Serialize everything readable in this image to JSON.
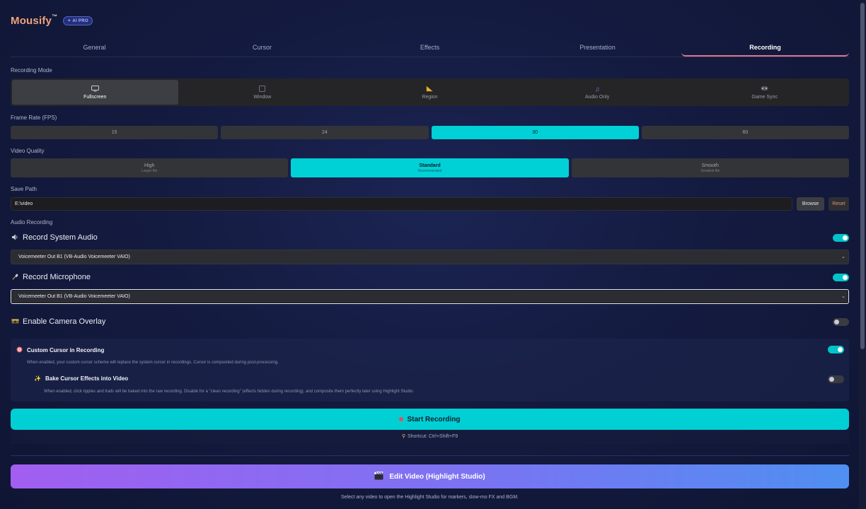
{
  "app": {
    "name": "Mousify",
    "trademark": "™",
    "badge": "✦ AI PRO"
  },
  "tabs": [
    {
      "label": "General"
    },
    {
      "label": "Cursor"
    },
    {
      "label": "Effects"
    },
    {
      "label": "Presentation"
    },
    {
      "label": "Recording"
    }
  ],
  "active_tab": "Recording",
  "recording_mode": {
    "label": "Recording Mode",
    "options": [
      {
        "label": "Fullscreen",
        "icon": "monitor-icon"
      },
      {
        "label": "Window",
        "icon": "window-icon"
      },
      {
        "label": "Region",
        "icon": "ruler-icon"
      },
      {
        "label": "Audio Only",
        "icon": "music-icon"
      },
      {
        "label": "Game Sync",
        "icon": "gamepad-icon"
      }
    ],
    "selected": "Fullscreen"
  },
  "frame_rate": {
    "label": "Frame Rate (FPS)",
    "options": [
      "15",
      "24",
      "30",
      "60"
    ],
    "selected": "30"
  },
  "video_quality": {
    "label": "Video Quality",
    "options": [
      {
        "title": "High",
        "subtitle": "Larger file"
      },
      {
        "title": "Standard",
        "subtitle": "Recommended"
      },
      {
        "title": "Smooth",
        "subtitle": "Smallest file"
      }
    ],
    "selected": "Standard"
  },
  "save_path": {
    "label": "Save Path",
    "value": "E:\\video",
    "browse_label": "Browse",
    "reset_label": "Reset"
  },
  "audio": {
    "label": "Audio Recording",
    "system_audio": {
      "title": "Record System Audio",
      "enabled": true,
      "device": "Voicemeeter Out B1 (VB-Audio Voicemeeter VAIO)"
    },
    "microphone": {
      "title": "Record Microphone",
      "enabled": true,
      "device": "Voicemeeter Out B1 (VB-Audio Voicemeeter VAIO)"
    }
  },
  "camera_overlay": {
    "title": "Enable Camera Overlay",
    "enabled": false
  },
  "custom_cursor": {
    "title": "Custom Cursor in Recording",
    "enabled": true,
    "description": "When enabled, your custom cursor scheme will replace the system cursor in recordings. Cursor is composited during post-processing.",
    "bake": {
      "title": "Bake Cursor Effects into Video",
      "enabled": false,
      "description": "When enabled, click ripples and trails will be baked into the raw recording. Disable for a \"clean recording\" (effects hidden during recording), and composite them perfectly later using Highlight Studio."
    }
  },
  "start_button": {
    "label": "Start Recording",
    "shortcut": "Shortcut: Ctrl+Shift+F9"
  },
  "edit_button": {
    "label": "Edit Video (Highlight Studio)"
  },
  "footer_note": "Select any video to open the Highlight Studio for markers, slow-mo FX and BGM.",
  "colors": {
    "accent": "#00d1d6",
    "logo": "#f0a27a",
    "record_dot": "#e84d5b",
    "edit_gradient_start": "#a25ef0",
    "edit_gradient_end": "#4f8ff1"
  }
}
